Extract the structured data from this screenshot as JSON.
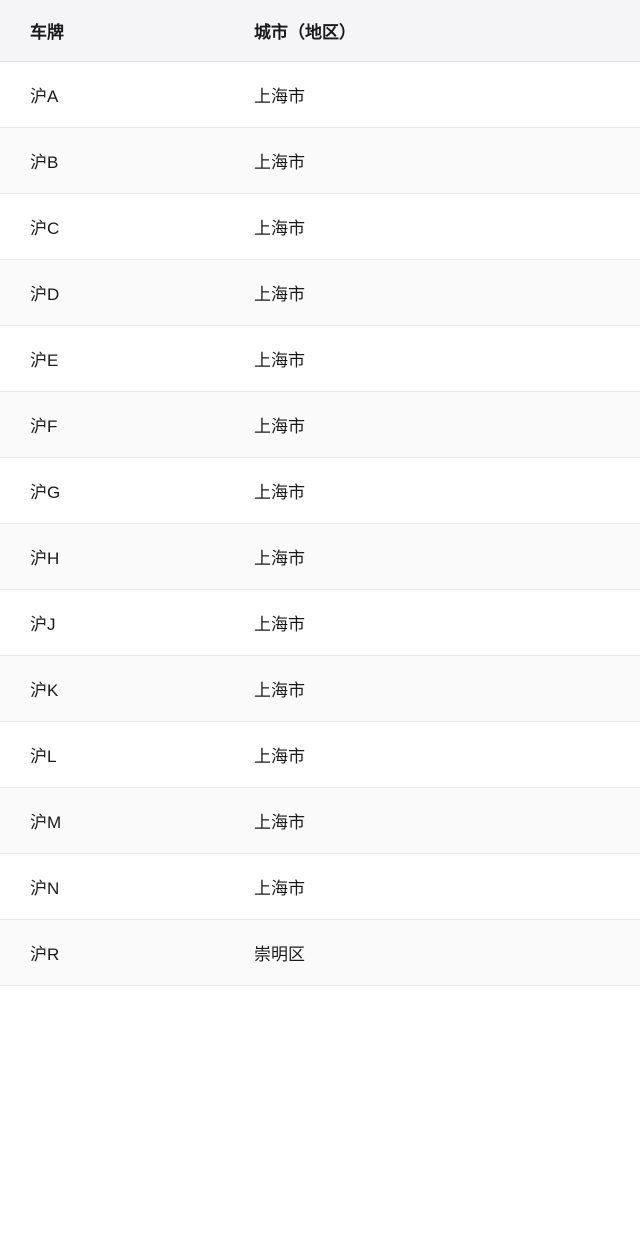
{
  "table": {
    "headers": {
      "plate": "车牌",
      "city": "城市（地区）"
    },
    "rows": [
      {
        "plate": "沪A",
        "city": "上海市"
      },
      {
        "plate": "沪B",
        "city": "上海市"
      },
      {
        "plate": "沪C",
        "city": "上海市"
      },
      {
        "plate": "沪D",
        "city": "上海市"
      },
      {
        "plate": "沪E",
        "city": "上海市"
      },
      {
        "plate": "沪F",
        "city": "上海市"
      },
      {
        "plate": "沪G",
        "city": "上海市"
      },
      {
        "plate": "沪H",
        "city": "上海市"
      },
      {
        "plate": "沪J",
        "city": "上海市"
      },
      {
        "plate": "沪K",
        "city": "上海市"
      },
      {
        "plate": "沪L",
        "city": "上海市"
      },
      {
        "plate": "沪M",
        "city": "上海市"
      },
      {
        "plate": "沪N",
        "city": "上海市"
      },
      {
        "plate": "沪R",
        "city": "崇明区"
      }
    ]
  }
}
